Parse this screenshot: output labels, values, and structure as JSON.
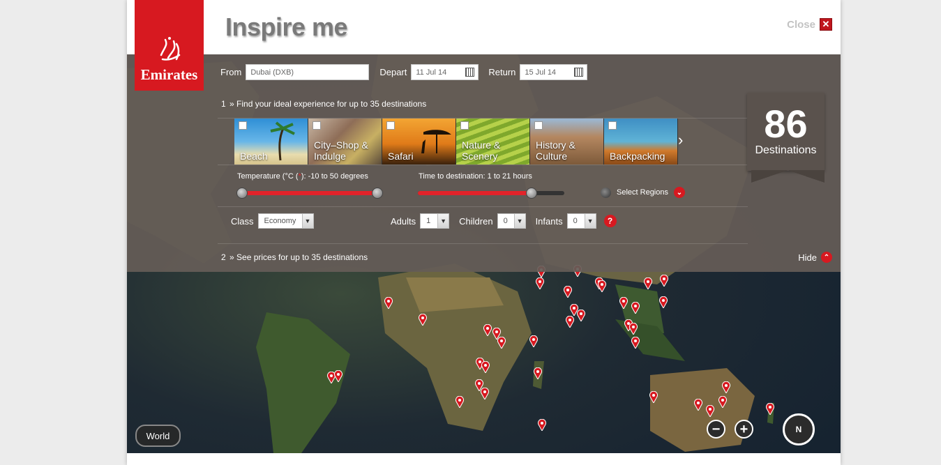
{
  "header": {
    "title": "Inspire me",
    "close_label": "Close"
  },
  "logo": {
    "text": "Emirates"
  },
  "search": {
    "from_label": "From",
    "from_value": "Dubai (DXB)",
    "depart_label": "Depart",
    "depart_value": "11 Jul 14",
    "return_label": "Return",
    "return_value": "15 Jul 14"
  },
  "step1": {
    "number": "1",
    "text": "Find your ideal experience for up to 35 destinations"
  },
  "categories": [
    {
      "label": "Beach"
    },
    {
      "label": "City–Shop & Indulge"
    },
    {
      "label": "Safari"
    },
    {
      "label": "Nature & Scenery"
    },
    {
      "label": "History & Culture"
    },
    {
      "label": "Backpacking"
    }
  ],
  "destinations": {
    "count": "86",
    "label": "Destinations"
  },
  "temperature": {
    "label_prefix": "Temperature (°C (",
    "star": "*",
    "label_suffix": "):",
    "range": "-10 to 50 degrees",
    "min_fraction": 0,
    "max_fraction": 1
  },
  "time": {
    "label": "Time to destination:",
    "range": "1 to 21 hours",
    "fraction": 0.8
  },
  "regions": {
    "label": "Select Regions"
  },
  "class": {
    "label": "Class",
    "value": "Economy"
  },
  "adults": {
    "label": "Adults",
    "value": "1"
  },
  "children": {
    "label": "Children",
    "value": "0"
  },
  "infants": {
    "label": "Infants",
    "value": "0"
  },
  "help": {
    "label": "?"
  },
  "step2": {
    "number": "2",
    "text": "See prices for up to 35 destinations"
  },
  "hide": {
    "label": "Hide"
  },
  "map": {
    "world_label": "World",
    "compass_label": "N",
    "zoom_out": "−",
    "zoom_in": "+"
  },
  "colors": {
    "brand_red": "#d71920",
    "panel": "#655d57"
  }
}
